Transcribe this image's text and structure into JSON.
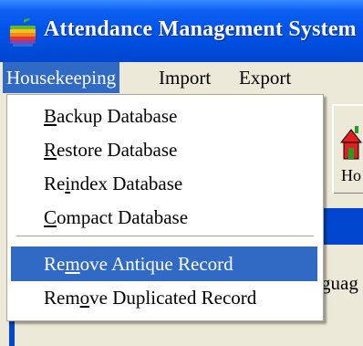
{
  "window": {
    "title": "Attendance Management System",
    "icon": "apple-icon"
  },
  "menubar": {
    "items": [
      {
        "label": "Housekeeping",
        "active": true
      },
      {
        "label": "Import",
        "active": false
      },
      {
        "label": "Export",
        "active": false
      }
    ]
  },
  "dropdown": {
    "items": [
      {
        "label": "Backup Database",
        "accel": "B",
        "highlighted": false
      },
      {
        "label": "Restore Database",
        "accel": "R",
        "highlighted": false
      },
      {
        "label": "Reindex Database",
        "accel": "i",
        "highlighted": false
      },
      {
        "label": "Compact Database",
        "accel": "C",
        "highlighted": false
      },
      {
        "label": "Remove Antique Record",
        "accel": "m",
        "highlighted": true
      },
      {
        "label": "Remove Duplicated Record",
        "accel": "o",
        "highlighted": false
      }
    ]
  },
  "background": {
    "toolbar_button_label": "Ho",
    "language_label": "guag"
  },
  "colors": {
    "titlebar": "#0052e6",
    "highlight": "#316ac5",
    "menubar": "#ece9d8"
  }
}
